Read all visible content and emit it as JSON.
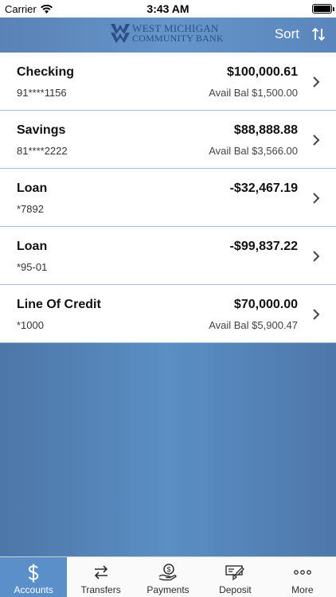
{
  "status_bar": {
    "carrier": "Carrier",
    "time": "3:43 AM",
    "battery_level": 1.0
  },
  "header": {
    "logo_line1": "West Michigan",
    "logo_line2": "Community Bank",
    "sort_label": "Sort",
    "colors": {
      "gradient_start": "#5a82b6",
      "gradient_mid": "#6595c9",
      "logo_text": "#2a4f86"
    }
  },
  "accounts": [
    {
      "name": "Checking",
      "number": "91****1156",
      "balance": "$100,000.61",
      "avail": "Avail Bal $1,500.00"
    },
    {
      "name": "Savings",
      "number": "81****2222",
      "balance": "$88,888.88",
      "avail": "Avail Bal $3,566.00"
    },
    {
      "name": "Loan",
      "number": "*7892",
      "balance": "-$32,467.19",
      "avail": ""
    },
    {
      "name": "Loan",
      "number": "*95-01",
      "balance": "-$99,837.22",
      "avail": ""
    },
    {
      "name": "Line Of Credit",
      "number": "*1000",
      "balance": "$70,000.00",
      "avail": "Avail Bal $5,900.47"
    }
  ],
  "tabs": [
    {
      "label": "Accounts",
      "icon": "dollar-icon",
      "active": true
    },
    {
      "label": "Transfers",
      "icon": "transfer-arrows-icon",
      "active": false
    },
    {
      "label": "Payments",
      "icon": "hand-coin-icon",
      "active": false
    },
    {
      "label": "Deposit",
      "icon": "check-deposit-icon",
      "active": false
    },
    {
      "label": "More",
      "icon": "ellipsis-icon",
      "active": false
    }
  ],
  "colors": {
    "active_tab": "#5a8fc9",
    "separator": "#a8bedb",
    "background_fill": "#5a8fc4"
  }
}
